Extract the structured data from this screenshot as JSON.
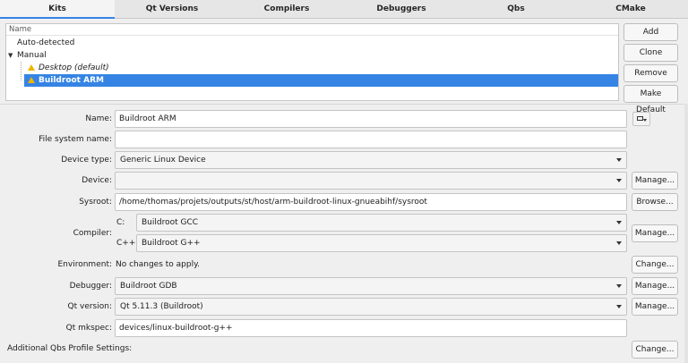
{
  "tabs": [
    {
      "label": "Kits",
      "active": true
    },
    {
      "label": "Qt Versions",
      "active": false
    },
    {
      "label": "Compilers",
      "active": false
    },
    {
      "label": "Debuggers",
      "active": false
    },
    {
      "label": "Qbs",
      "active": false
    },
    {
      "label": "CMake",
      "active": false
    }
  ],
  "tree": {
    "header": "Name",
    "auto_detected": "Auto-detected",
    "manual": "Manual",
    "desktop": "Desktop (default)",
    "buildroot": "Buildroot ARM"
  },
  "side_buttons": {
    "add": "Add",
    "clone": "Clone",
    "remove": "Remove",
    "make_default": "Make Default"
  },
  "form": {
    "name_label": "Name:",
    "name_value": "Buildroot ARM",
    "fsname_label": "File system name:",
    "fsname_value": "",
    "device_type_label": "Device type:",
    "device_type_value": "Generic Linux Device",
    "device_label": "Device:",
    "device_value": "",
    "sysroot_label": "Sysroot:",
    "sysroot_value": "/home/thomas/projets/outputs/st/host/arm-buildroot-linux-gnueabihf/sysroot",
    "compiler_label": "Compiler:",
    "c_label": "C:",
    "c_value": "Buildroot GCC",
    "cpp_label": "C++:",
    "cpp_value": "Buildroot G++",
    "environment_label": "Environment:",
    "environment_value": "No changes to apply.",
    "debugger_label": "Debugger:",
    "debugger_value": "Buildroot GDB",
    "qtversion_label": "Qt version:",
    "qtversion_value": "Qt 5.11.3 (Buildroot)",
    "mkspec_label": "Qt mkspec:",
    "mkspec_value": "devices/linux-buildroot-g++",
    "qbs_label": "Additional Qbs Profile Settings:"
  },
  "buttons": {
    "manage": "Manage...",
    "browse": "Browse...",
    "change": "Change..."
  },
  "colors": {
    "accent": "#3584e4",
    "warning": "#f0b400"
  }
}
